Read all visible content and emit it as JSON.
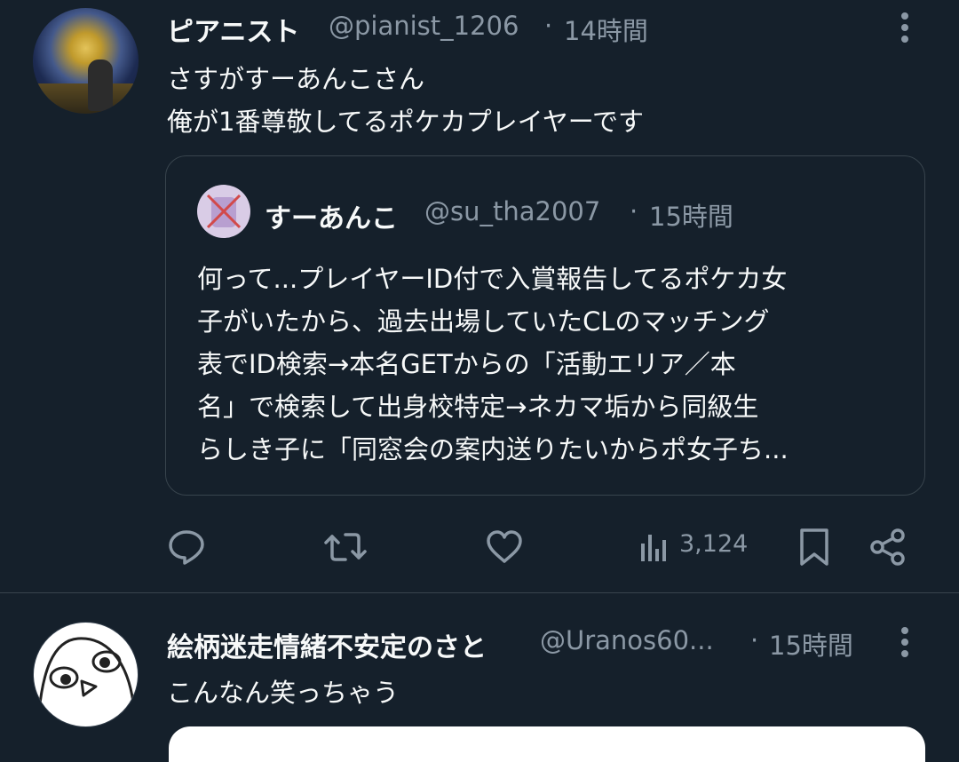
{
  "tweet1": {
    "display_name": "ピアニスト",
    "handle": "@pianist_1206",
    "separator": "·",
    "time": "14時間",
    "body_lines": [
      "さすがすーあんこさん",
      "俺が1番尊敬してるポケカプレイヤーです"
    ],
    "quote": {
      "display_name": "すーあんこ",
      "handle": "@su_tha2007",
      "separator": "·",
      "time": "15時間",
      "text_lines": [
        "何って...プレイヤーID付で入賞報告してるポケカ女",
        "子がいたから、過去出場していたCLのマッチング",
        "表でID検索→本名GETからの「活動エリア／本",
        "名」で検索して出身校特定→ネカマ垢から同級生",
        "らしき子に「同窓会の案内送りたいからポ女子ち..."
      ]
    },
    "views": "3,124",
    "icons": {
      "reply": "reply-icon",
      "retweet": "retweet-icon",
      "like": "like-icon",
      "views": "views-icon",
      "bookmark": "bookmark-icon",
      "share": "share-icon",
      "more": "more-icon"
    }
  },
  "tweet2": {
    "display_name": "絵柄迷走情緒不安定のさと",
    "handle": "@Uranos60...",
    "separator": "·",
    "time": "15時間",
    "body_lines": [
      "こんなん笑っちゃう"
    ]
  },
  "colors": {
    "background": "#15202b",
    "primary_text": "#f7f9f9",
    "secondary_text": "#8b98a5",
    "border": "#38444d"
  }
}
